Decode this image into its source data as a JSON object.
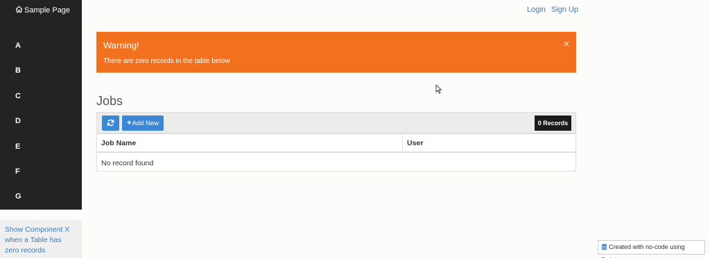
{
  "sidebar": {
    "brand": "Sample Page",
    "items": [
      {
        "label": "A"
      },
      {
        "label": "B"
      },
      {
        "label": "C"
      },
      {
        "label": "D"
      },
      {
        "label": "E"
      },
      {
        "label": "F"
      },
      {
        "label": "G"
      }
    ],
    "footer_link": "Show Component X when a Table has zero records"
  },
  "header": {
    "login": "Login",
    "signup": "Sign Up"
  },
  "alert": {
    "title": "Warning!",
    "message": "There are zero records in the table below",
    "close": "×",
    "color": "#f1711f"
  },
  "jobs": {
    "title": "Jobs",
    "add_label": "Add New",
    "records_badge": "0 Records",
    "columns": [
      "Job Name",
      "User"
    ],
    "empty_message": "No record found"
  },
  "footer": {
    "tadabase": "Created with no-code using Tadabase"
  },
  "icons": {
    "home": "home-icon",
    "refresh": "refresh-icon",
    "plus": "plus-icon",
    "close": "close-icon",
    "database": "database-icon"
  }
}
